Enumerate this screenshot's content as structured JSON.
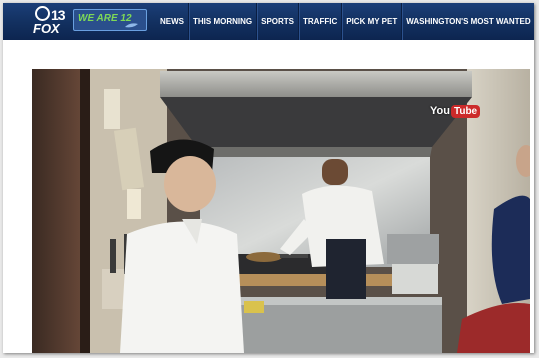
{
  "header": {
    "logo": {
      "station_number": "13",
      "network": "FOX"
    },
    "promo": {
      "text": "WE ARE 12"
    },
    "nav": [
      {
        "label": "NEWS"
      },
      {
        "label": "THIS MORNING"
      },
      {
        "label": "SPORTS"
      },
      {
        "label": "TRAFFIC"
      },
      {
        "label": "PICK MY PET"
      },
      {
        "label": "WASHINGTON'S MOST WANTED"
      }
    ]
  },
  "video": {
    "watermark": {
      "part1": "You",
      "part2": "Tube"
    }
  },
  "colors": {
    "nav_bar": "#12305f",
    "promo_green": "#7ed957",
    "youtube_red": "#cc2a2a"
  },
  "icons": {
    "video_content": "kitchen-scene-image"
  }
}
